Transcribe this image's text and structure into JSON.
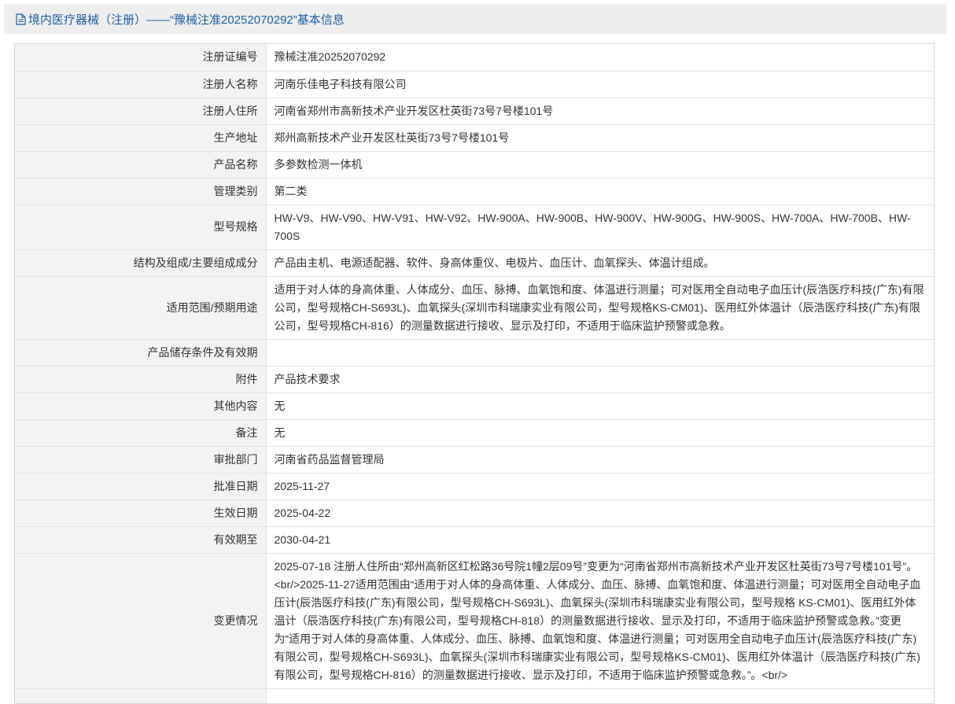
{
  "header": {
    "title": "境内医疗器械（注册）——“豫械注准20252070292”基本信息"
  },
  "rows": [
    {
      "label": "注册证编号",
      "value": "豫械注准20252070292"
    },
    {
      "label": "注册人名称",
      "value": "河南乐佳电子科技有限公司"
    },
    {
      "label": "注册人住所",
      "value": "河南省郑州市高新技术产业开发区杜英街73号7号楼101号"
    },
    {
      "label": "生产地址",
      "value": "郑州高新技术产业开发区杜英街73号7号楼101号"
    },
    {
      "label": "产品名称",
      "value": "多参数检测一体机"
    },
    {
      "label": "管理类别",
      "value": "第二类"
    },
    {
      "label": "型号规格",
      "value": "HW-V9、HW-V90、HW-V91、HW-V92、HW-900A、HW-900B、HW-900V、HW-900G、HW-900S、HW-700A、HW-700B、HW-700S"
    },
    {
      "label": "结构及组成/主要组成成分",
      "value": "产品由主机、电源适配器、软件、身高体重仪、电极片、血压计、血氧探头、体温计组成。"
    },
    {
      "label": "适用范围/预期用途",
      "value": "适用于对人体的身高体重、人体成分、血压、脉搏、血氧饱和度、体温进行测量；可对医用全自动电子血压计(辰浩医疗科技(广东)有限公司，型号规格CH-S693L)、血氧探头(深圳市科瑞康实业有限公司，型号规格KS-CM01)、医用红外体温计（辰浩医疗科技(广东)有限公司，型号规格CH-816）的测量数据进行接收、显示及打印，不适用于临床监护预警或急救。"
    },
    {
      "label": "产品储存条件及有效期",
      "value": ""
    },
    {
      "label": "附件",
      "value": "产品技术要求"
    },
    {
      "label": "其他内容",
      "value": "无"
    },
    {
      "label": "备注",
      "value": "无"
    },
    {
      "label": "审批部门",
      "value": "河南省药品监督管理局"
    },
    {
      "label": "批准日期",
      "value": "2025-11-27"
    },
    {
      "label": "生效日期",
      "value": "2025-04-22"
    },
    {
      "label": "有效期至",
      "value": "2030-04-21"
    },
    {
      "label": "变更情况",
      "value": "2025-07-18 注册人住所由“郑州高新区红松路36号院1幢2层09号”变更为“河南省郑州市高新技术产业开发区杜英街73号7号楼101号”。<br/>2025-11-27适用范围由“适用于对人体的身高体重、人体成分、血压、脉搏、血氧饱和度、体温进行测量；可对医用全自动电子血压计(辰浩医疗科技(广东)有限公司，型号规格CH-S693L)、血氧探头(深圳市科瑞康实业有限公司，型号规格 KS-CM01)、医用红外体温计（辰浩医疗科技(广东)有限公司，型号规格CH-818）的测量数据进行接收、显示及打印，不适用于临床监护预警或急救。”变更为“适用于对人体的身高体重、人体成分、血压、脉搏、血氧饱和度、体温进行测量；可对医用全自动电子血压计(辰浩医疗科技(广东)有限公司，型号规格CH-S693L)、血氧探头(深圳市科瑞康实业有限公司，型号规格KS-CM01)、医用红外体温计（辰浩医疗科技(广东)有限公司，型号规格CH-816）的测量数据进行接收、显示及打印，不适用于临床监护预警或急救。”。<br/>"
    }
  ]
}
